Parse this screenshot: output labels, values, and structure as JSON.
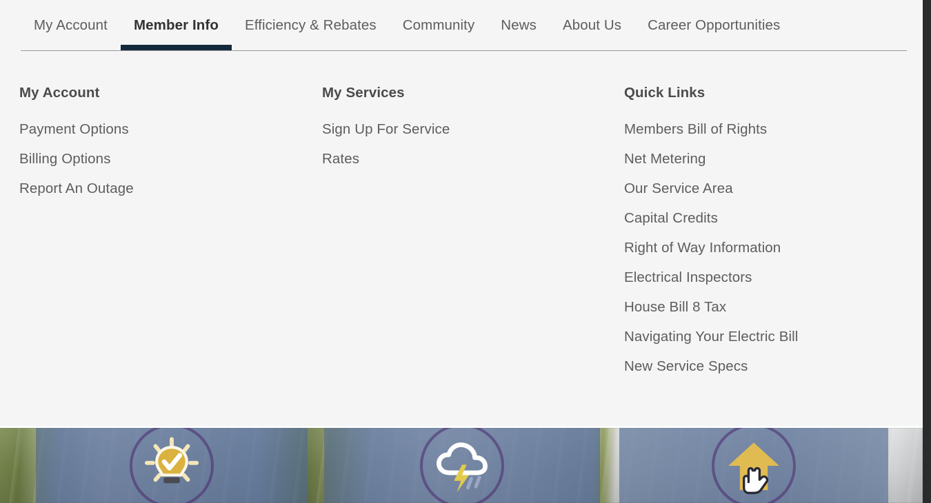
{
  "page": {
    "background_color": "#f5f5f5",
    "accent_color": "#15293c",
    "heading_color": "#4b4b4b",
    "link_color": "#5d5d5d"
  },
  "nav": {
    "items": [
      {
        "label": "My Account",
        "active": false
      },
      {
        "label": "Member Info",
        "active": true
      },
      {
        "label": "Efficiency & Rebates",
        "active": false
      },
      {
        "label": "Community",
        "active": false
      },
      {
        "label": "News",
        "active": false
      },
      {
        "label": "About Us",
        "active": false
      },
      {
        "label": "Career Opportunities",
        "active": false
      }
    ]
  },
  "columns": [
    {
      "title": "My Account",
      "links": [
        "Payment Options",
        "Billing Options",
        "Report An Outage"
      ]
    },
    {
      "title": "My Services",
      "links": [
        "Sign Up For Service",
        "Rates"
      ]
    },
    {
      "title": "Quick Links",
      "links": [
        "Members Bill of Rights",
        "Net Metering",
        "Our Service Area",
        "Capital Credits",
        "Right of Way Information",
        "Electrical Inspectors",
        "House Bill 8 Tax",
        "Navigating Your Electric Bill",
        "New Service Specs"
      ]
    }
  ],
  "banner": {
    "panels": [
      {
        "icon": "lightbulb-check-icon",
        "icon_color": "#d9b23f",
        "ring_color": "#4a286e"
      },
      {
        "icon": "storm-cloud-lightning-icon",
        "icon_color": "#e2cb4c",
        "ring_color": "#4a286e"
      },
      {
        "icon": "house-cursor-icon",
        "icon_color": "#e0bb52",
        "ring_color": "#4a286e"
      }
    ],
    "overlay_color": "#4e6791"
  }
}
